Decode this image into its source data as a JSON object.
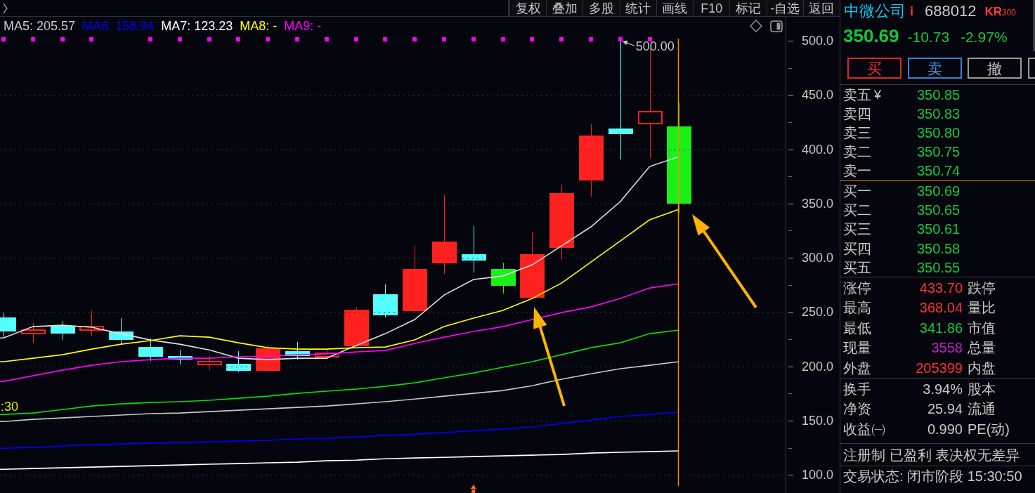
{
  "top_bar": {
    "toolbar": [
      "复权",
      "叠加",
      "多股",
      "统计",
      "画线",
      "F10",
      "标记",
      "-自选",
      "返回"
    ]
  },
  "chart": {
    "legend": [
      {
        "label": "MA5: 205.57",
        "color": "#c8c8c8"
      },
      {
        "label": "MA6: 158.94",
        "color": "#0000ff"
      },
      {
        "label": "MA7: 123.23",
        "color": "#ffffff"
      },
      {
        "label": "MA8: -",
        "color": "#ffff00"
      },
      {
        "label": "MA9: -",
        "color": "#ff00ff"
      }
    ],
    "edge_label": ":30",
    "high_label": "500.00",
    "candles": [
      {
        "color": "#54ffff",
        "hollow": false,
        "marker": true
      },
      {
        "color": "#ff2020",
        "hollow": true,
        "marker": true
      },
      {
        "color": "#54ffff",
        "hollow": false,
        "marker": true
      },
      {
        "color": "#ff2020",
        "hollow": true,
        "marker": true
      },
      {
        "color": "#54ffff",
        "hollow": false,
        "marker": false
      },
      {
        "color": "#54ffff",
        "hollow": false,
        "marker": true
      },
      {
        "color": "#54ffff",
        "hollow": false,
        "marker": true
      },
      {
        "color": "#ff2020",
        "hollow": true,
        "marker": true
      },
      {
        "color": "#54ffff",
        "hollow": false,
        "marker": true
      },
      {
        "color": "#ff2020",
        "hollow": false,
        "marker": true
      },
      {
        "color": "#54ffff",
        "hollow": false,
        "marker": true
      },
      {
        "color": "#ff2020",
        "hollow": true,
        "marker": true
      },
      {
        "color": "#ff2020",
        "hollow": false,
        "marker": true
      },
      {
        "color": "#54ffff",
        "hollow": false,
        "marker": true
      },
      {
        "color": "#ff2020",
        "hollow": false,
        "marker": true
      },
      {
        "color": "#ff2020",
        "hollow": false,
        "marker": true
      },
      {
        "color": "#54ffff",
        "hollow": false,
        "marker": true
      },
      {
        "color": "#18f018",
        "hollow": false,
        "marker": true
      },
      {
        "color": "#ff2020",
        "hollow": false,
        "marker": true
      },
      {
        "color": "#ff2020",
        "hollow": false,
        "marker": true
      },
      {
        "color": "#ff2020",
        "hollow": false,
        "marker": true
      },
      {
        "color": "#54ffff",
        "hollow": false,
        "marker": true
      },
      {
        "color": "#ff2020",
        "hollow": true,
        "marker": true
      },
      {
        "color": "#18f018",
        "hollow": false,
        "marker": false
      }
    ],
    "chart_data": {
      "type": "line",
      "ylim": [
        83.3,
        522.0
      ],
      "grid": true,
      "yticks": [
        {
          "value": 100,
          "label": "100.0"
        },
        {
          "value": 150,
          "label": "150.0"
        },
        {
          "value": 200,
          "label": "200.0"
        },
        {
          "value": 250,
          "label": "250.0"
        },
        {
          "value": 300,
          "label": "300.0"
        },
        {
          "value": 350,
          "label": "350.0"
        },
        {
          "value": 400,
          "label": "400.0"
        },
        {
          "value": 450,
          "label": "450.0"
        },
        {
          "value": 500,
          "label": "500.0"
        }
      ],
      "series": [
        {
          "color": "#e0e0e0",
          "values": [
            226.2,
            236.6,
            237.9,
            236.0,
            230.1,
            224.3,
            220.4,
            215.2,
            207.5,
            206.2,
            207.5,
            207.5,
            219.1,
            230.1,
            243.1,
            265.7,
            280.0,
            283.2,
            293.5,
            311.0,
            328.5,
            351.8,
            384.1,
            393.2
          ]
        },
        {
          "color": "#ffff00",
          "values": [
            204.3,
            207.5,
            210.7,
            215.9,
            220.4,
            223.7,
            228.2,
            226.9,
            221.7,
            217.2,
            215.9,
            215.9,
            217.2,
            217.8,
            224.3,
            236.6,
            244.4,
            251.5,
            262.5,
            276.7,
            296.1,
            315.5,
            335.0,
            344.7
          ]
        },
        {
          "color": "#ff00ff",
          "values": [
            186.1,
            191.3,
            196.5,
            201.0,
            204.3,
            206.2,
            207.5,
            207.5,
            208.8,
            209.4,
            210.7,
            211.4,
            213.3,
            214.6,
            221.1,
            226.9,
            232.1,
            236.6,
            243.1,
            249.5,
            254.7,
            262.5,
            272.2,
            276.1
          ]
        },
        {
          "color": "#00e000",
          "values": [
            155.7,
            157.0,
            160.2,
            163.5,
            165.4,
            166.7,
            167.4,
            168.7,
            170.6,
            172.5,
            175.1,
            177.1,
            179.0,
            181.6,
            184.8,
            189.4,
            193.9,
            199.1,
            204.3,
            210.7,
            217.2,
            221.7,
            230.1,
            233.4
          ]
        },
        {
          "color": "#c8c8c8",
          "values": [
            149.2,
            151.2,
            152.5,
            153.8,
            155.1,
            156.4,
            157.0,
            158.3,
            159.6,
            160.9,
            162.2,
            163.5,
            165.4,
            167.4,
            169.9,
            172.5,
            175.1,
            177.7,
            182.2,
            188.1,
            193.2,
            197.8,
            201.0,
            204.3
          ]
        },
        {
          "color": "#0000ff",
          "values": [
            124.6,
            125.3,
            126.6,
            127.9,
            128.5,
            129.2,
            129.8,
            130.5,
            131.1,
            131.8,
            133.1,
            133.7,
            135.0,
            136.3,
            137.6,
            138.9,
            140.8,
            142.1,
            144.1,
            147.3,
            150.5,
            153.8,
            155.7,
            157.7
          ]
        },
        {
          "color": "#ffffff",
          "values": [
            105.2,
            105.9,
            106.5,
            107.2,
            107.8,
            108.5,
            109.1,
            109.8,
            110.4,
            111.1,
            111.7,
            113.0,
            113.6,
            114.9,
            115.6,
            116.2,
            116.9,
            117.5,
            118.2,
            118.8,
            120.1,
            120.8,
            121.4,
            122.1
          ]
        }
      ]
    }
  },
  "quote_panel": {
    "name": "中微公司",
    "marker": "i",
    "code": "688012",
    "badge_letters": "KR",
    "badge_number": "300",
    "price": "350.69",
    "change": "-10.73",
    "change_percent": "-2.97%",
    "buttons": [
      {
        "label": "买",
        "kind": "buy"
      },
      {
        "label": "卖",
        "kind": "sell"
      },
      {
        "label": "撤",
        "kind": "cancel"
      },
      {
        "kind": "more"
      }
    ],
    "asks": [
      {
        "label": "卖五",
        "symbol": "¥",
        "price": "350.85"
      },
      {
        "label": "卖四",
        "price": "350.83"
      },
      {
        "label": "卖三",
        "price": "350.80"
      },
      {
        "label": "卖二",
        "price": "350.75"
      },
      {
        "label": "卖一",
        "price": "350.74"
      }
    ],
    "bids": [
      {
        "label": "买一",
        "price": "350.69"
      },
      {
        "label": "买二",
        "price": "350.65"
      },
      {
        "label": "买三",
        "price": "350.61"
      },
      {
        "label": "买四",
        "price": "350.58"
      },
      {
        "label": "买五",
        "price": "350.55"
      }
    ],
    "stats": [
      {
        "label": "涨停",
        "value": "433.70",
        "color": "#ff3232",
        "label_2": "跌停"
      },
      {
        "label": "最高",
        "value": "368.04",
        "color": "#ff3232",
        "label_2": "量比"
      },
      {
        "label": "最低",
        "value": "341.86",
        "color": "#14c83c",
        "label_2": "市值"
      },
      {
        "label": "现量",
        "value": "3558",
        "color": "#c020c8",
        "label_2": "总量"
      },
      {
        "label": "外盘",
        "value": "205399",
        "color": "#ff3232",
        "label_2": "内盘"
      }
    ],
    "fundamentals": [
      {
        "label": "换手",
        "value": "3.94%",
        "label_2": "股本"
      },
      {
        "label": "净资",
        "value": "25.94",
        "label_2": "流通"
      },
      {
        "label": "收益㈠",
        "value": "0.990",
        "label_2": "PE(动)"
      }
    ],
    "tags": "注册制 已盈利 表决权无差异",
    "status": "交易状态: 闭市阶段 15:30:50"
  }
}
